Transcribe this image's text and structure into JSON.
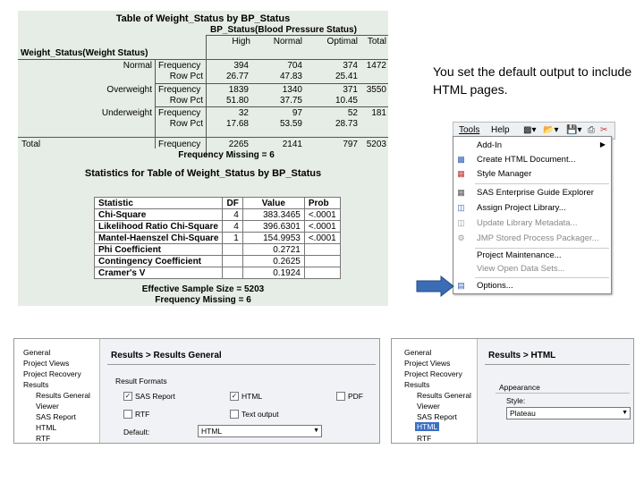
{
  "crosstab": {
    "title": "Table of Weight_Status by BP_Status",
    "col_group": "BP_Status(Blood Pressure Status)",
    "columns": [
      "High",
      "Normal",
      "Optimal",
      "Total"
    ],
    "row_var": "Weight_Status(Weight Status)",
    "rows": [
      {
        "label": "Normal",
        "stats": [
          "Frequency",
          "Row Pct"
        ],
        "values": [
          [
            "394",
            "704",
            "374",
            "1472"
          ],
          [
            "26.77",
            "47.83",
            "25.41",
            ""
          ]
        ]
      },
      {
        "label": "Overweight",
        "stats": [
          "Frequency",
          "Row Pct"
        ],
        "values": [
          [
            "1839",
            "1340",
            "371",
            "3550"
          ],
          [
            "51.80",
            "37.75",
            "10.45",
            ""
          ]
        ]
      },
      {
        "label": "Underweight",
        "stats": [
          "Frequency",
          "Row Pct"
        ],
        "values": [
          [
            "32",
            "97",
            "52",
            "181"
          ],
          [
            "17.68",
            "53.59",
            "28.73",
            ""
          ]
        ]
      }
    ],
    "total": {
      "label": "Total",
      "stat": "Frequency",
      "values": [
        "2265",
        "2141",
        "797",
        "5203"
      ]
    },
    "missing": "Frequency Missing = 6"
  },
  "stats": {
    "title": "Statistics for Table of Weight_Status by BP_Status",
    "headers": [
      "Statistic",
      "DF",
      "Value",
      "Prob"
    ],
    "rows": [
      [
        "Chi-Square",
        "4",
        "383.3465",
        "<.0001"
      ],
      [
        "Likelihood Ratio Chi-Square",
        "4",
        "396.6301",
        "<.0001"
      ],
      [
        "Mantel-Haenszel Chi-Square",
        "1",
        "154.9953",
        "<.0001"
      ],
      [
        "Phi Coefficient",
        "",
        "0.2721",
        ""
      ],
      [
        "Contingency Coefficient",
        "",
        "0.2625",
        ""
      ],
      [
        "Cramer's V",
        "",
        "0.1924",
        ""
      ]
    ],
    "sample_size": "Effective Sample Size = 5203",
    "missing": "Frequency Missing = 6"
  },
  "caption": "You set the default output to include HTML pages.",
  "menubar": {
    "tools": "Tools",
    "help": "Help"
  },
  "tools_menu": [
    {
      "label": "Add-In",
      "icon": "blank",
      "submenu": true,
      "disabled": false
    },
    {
      "label": "Create HTML Document...",
      "icon": "html-doc-icon",
      "disabled": false
    },
    {
      "label": "Style Manager",
      "icon": "style-icon",
      "disabled": false
    },
    {
      "label": "SAS Enterprise Guide Explorer",
      "icon": "explorer-icon",
      "disabled": false
    },
    {
      "label": "Assign Project Library...",
      "icon": "library-icon",
      "disabled": false
    },
    {
      "label": "Update Library Metadata...",
      "icon": "metadata-icon",
      "disabled": true
    },
    {
      "label": "JMP Stored Process Packager...",
      "icon": "jmp-icon",
      "disabled": true
    },
    {
      "label": "Project Maintenance...",
      "icon": "blank",
      "disabled": false
    },
    {
      "label": "View Open Data Sets...",
      "icon": "blank",
      "disabled": true
    },
    {
      "label": "Options...",
      "icon": "options-icon",
      "disabled": false
    }
  ],
  "dialog_general": {
    "nav": [
      "General",
      "Project Views",
      "Project Recovery",
      "Results",
      "Results General",
      "Viewer",
      "SAS Report",
      "HTML",
      "RTF"
    ],
    "header": "Results > Results General",
    "section": "Result Formats",
    "formats": [
      {
        "label": "SAS Report",
        "checked": true
      },
      {
        "label": "HTML",
        "checked": true
      },
      {
        "label": "PDF",
        "checked": false
      },
      {
        "label": "RTF",
        "checked": false
      },
      {
        "label": "Text output",
        "checked": false
      }
    ],
    "default_label": "Default:",
    "default_value": "HTML"
  },
  "dialog_html": {
    "nav": [
      "General",
      "Project Views",
      "Project Recovery",
      "Results",
      "Results General",
      "Viewer",
      "SAS Report",
      "HTML",
      "RTF"
    ],
    "header": "Results > HTML",
    "section": "Appearance",
    "style_label": "Style:",
    "style_value": "Plateau"
  },
  "colors": {
    "panel_bg": "#e6ece6",
    "highlight": "#3a6fc4",
    "arrow": "#3b6db5"
  }
}
